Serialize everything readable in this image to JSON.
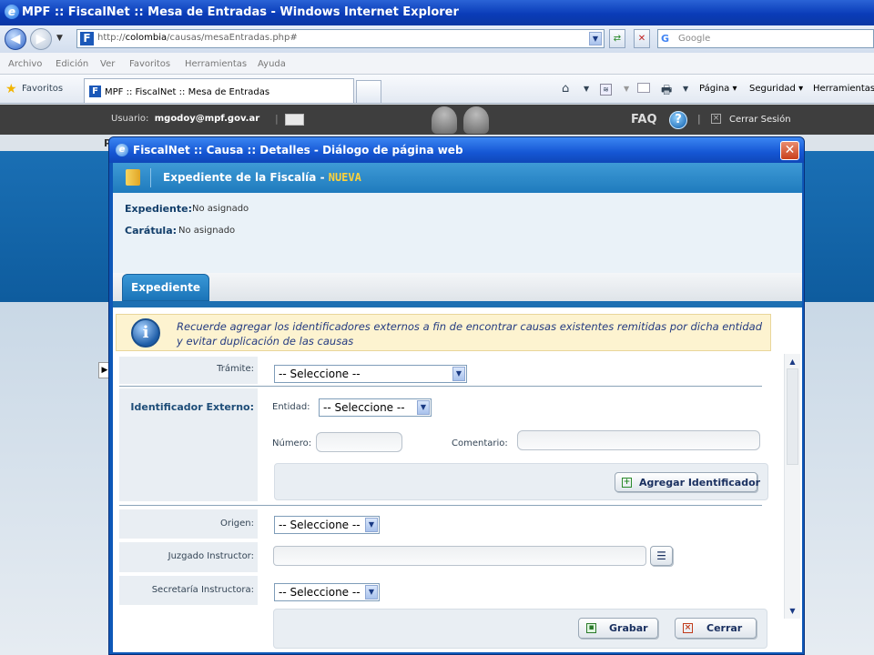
{
  "browser": {
    "window_title": "MPF :: FiscalNet :: Mesa de Entradas - Windows Internet Explorer",
    "url_prefix": "http://",
    "url_host": "colombia",
    "url_path": "/causas/mesaEntradas.php#",
    "search_placeholder": "Google",
    "menu": [
      "Archivo",
      "Edición",
      "Ver",
      "Favoritos",
      "Herramientas",
      "Ayuda"
    ],
    "favorites_label": "Favoritos",
    "tab_title": "MPF :: FiscalNet :: Mesa de Entradas",
    "commands": {
      "page": "Página",
      "safety": "Seguridad",
      "tools": "Herramientas"
    }
  },
  "app_header": {
    "user_label": "Usuario:",
    "user_email": "mgodoy@mpf.gov.ar",
    "faq": "FAQ",
    "help": "?",
    "logout": "Cerrar Sesión",
    "bg_letter": "P"
  },
  "dialog": {
    "title": "FiscalNet :: Causa :: Detalles - Diálogo de página web",
    "section_title": "Expediente de la Fiscalía -",
    "section_status": "NUEVA",
    "expediente_label": "Expediente:",
    "expediente_value": "No asignado",
    "caratula_label": "Carátula:",
    "caratula_value": "No asignado",
    "tab_label": "Expediente",
    "alert_text": "Recuerde agregar los identificadores externos a fin de encontrar causas existentes remitidas por dicha entidad y evitar duplicación de las causas",
    "form": {
      "tramite_label": "Trámite:",
      "tramite_value": "-- Seleccione --",
      "identificador_label": "Identificador Externo:",
      "entidad_label": "Entidad:",
      "entidad_value": "-- Seleccione --",
      "numero_label": "Número:",
      "comentario_label": "Comentario:",
      "agregar_button": "Agregar Identificador",
      "origen_label": "Origen:",
      "origen_value": "-- Seleccione --",
      "juzgado_label": "Juzgado Instructor:",
      "secretaria_label": "Secretaría Instructora:",
      "secretaria_value": "-- Seleccione --"
    },
    "footer": {
      "save_button": "Grabar",
      "close_button": "Cerrar"
    }
  },
  "colors": {
    "dialog_frame": "#0e58b8",
    "section_header": "#1f7bbd",
    "accent_status": "#ffd23a",
    "alert_bg": "#fdf3d0"
  }
}
